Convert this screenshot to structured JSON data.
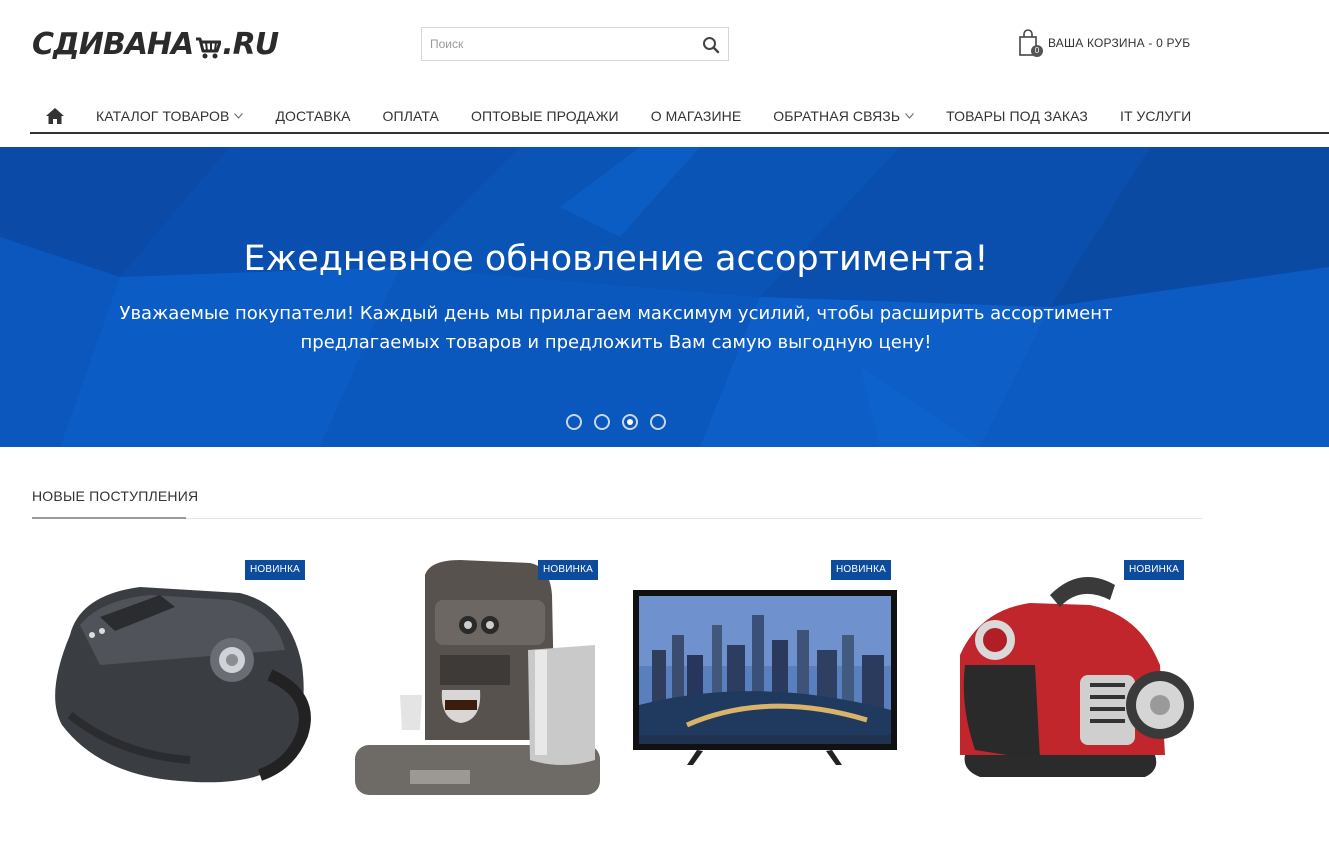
{
  "header": {
    "logo_text_main": "СДИВАНА",
    "logo_text_tld": "RU",
    "search_placeholder": "Поиск",
    "basket_label": "ВАША КОРЗИНА - 0 РУБ",
    "basket_count": "0"
  },
  "nav": {
    "items": [
      {
        "label": "КАТАЛОГ ТОВАРОВ",
        "has_dropdown": true
      },
      {
        "label": "ДОСТАВКА",
        "has_dropdown": false
      },
      {
        "label": "ОПЛАТА",
        "has_dropdown": false
      },
      {
        "label": "ОПТОВЫЕ ПРОДАЖИ",
        "has_dropdown": false
      },
      {
        "label": "О МАГАЗИНЕ",
        "has_dropdown": false
      },
      {
        "label": "ОБРАТНАЯ СВЯЗЬ",
        "has_dropdown": true
      },
      {
        "label": "ТОВАРЫ ПОД ЗАКАЗ",
        "has_dropdown": false
      },
      {
        "label": "IT УСЛУГИ",
        "has_dropdown": false
      }
    ]
  },
  "banner": {
    "title": "Ежедневное обновление ассортимента!",
    "text": "Уважаемые покупатели! Каждый день мы прилагаем максимум усилий, чтобы расширить ассортимент предлагаемых товаров и предложить Вам самую выгодную цену!",
    "slides_total": 4,
    "active_slide": 3,
    "bg_color": "#0a52b7"
  },
  "new_arrivals": {
    "title": "НОВЫЕ ПОСТУПЛЕНИЯ",
    "products": [
      {
        "image": "vacuum-cleaner-black",
        "badge": "НОВИНКА"
      },
      {
        "image": "coffee-machine",
        "badge": "НОВИНКА"
      },
      {
        "image": "tv-set",
        "badge": "НОВИНКА"
      },
      {
        "image": "vacuum-cleaner-red",
        "badge": "НОВИНКА"
      }
    ]
  }
}
